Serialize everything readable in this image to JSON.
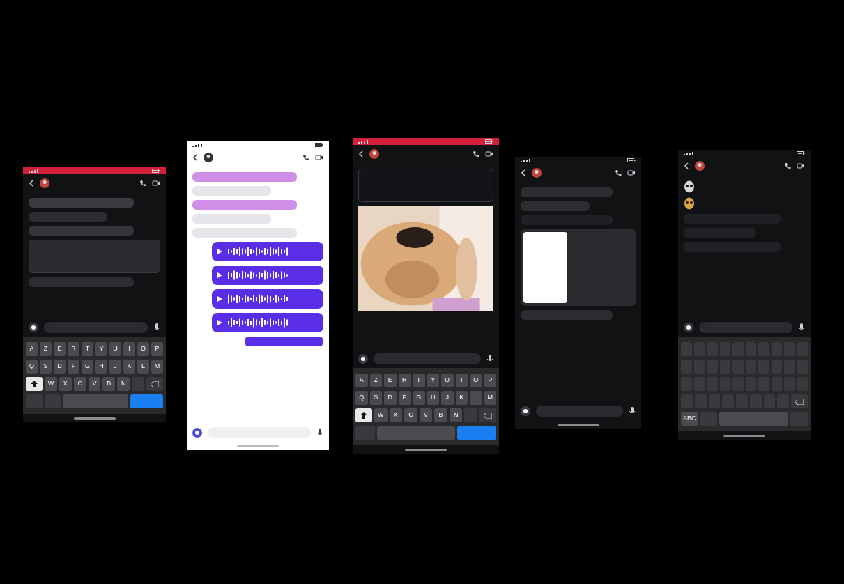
{
  "phones": [
    {
      "kind": "dark",
      "status_bar": {
        "color": "#d3203a"
      },
      "blocks": [
        {
          "kind": "bar-left",
          "color": "#3a3b40"
        },
        {
          "kind": "bar-left",
          "color": "#2c2d31"
        },
        {
          "kind": "bar-left",
          "color": "#34353a"
        },
        {
          "kind": "card-left",
          "color": "#2a2b30"
        },
        {
          "kind": "bar-left",
          "color": "#2c2d31"
        }
      ],
      "keyboard": {
        "rows": [
          [
            {
              "label": "A"
            },
            {
              "label": "Z"
            },
            {
              "label": "E"
            },
            {
              "label": "R"
            },
            {
              "label": "T"
            },
            {
              "label": "Y"
            },
            {
              "label": "U"
            },
            {
              "label": "I"
            },
            {
              "label": "O"
            },
            {
              "label": "P"
            }
          ],
          [
            {
              "label": "Q"
            },
            {
              "label": "S"
            },
            {
              "label": "D"
            },
            {
              "label": "F"
            },
            {
              "label": "G"
            },
            {
              "label": "H"
            },
            {
              "label": "J"
            },
            {
              "label": "K"
            },
            {
              "label": "L"
            },
            {
              "label": "M"
            }
          ],
          [
            {
              "kind": "shift"
            },
            {
              "label": "W"
            },
            {
              "label": "X"
            },
            {
              "label": "C"
            },
            {
              "label": "V"
            },
            {
              "label": "B"
            },
            {
              "label": "N"
            },
            {
              "kind": "blank"
            },
            {
              "kind": "backspace"
            }
          ],
          [
            {
              "kind": "blank"
            },
            {
              "kind": "blank"
            },
            {
              "kind": "space"
            },
            {
              "kind": "action",
              "color": "#1a7ff0"
            }
          ]
        ]
      }
    },
    {
      "kind": "light",
      "blocks": [
        {
          "kind": "bar-left",
          "color": "#cf8fe6"
        },
        {
          "kind": "bar-left",
          "color": "#e6e6ea"
        },
        {
          "kind": "bar-left",
          "color": "#cf8fe6"
        },
        {
          "kind": "bar-left",
          "color": "#e6e6ea"
        },
        {
          "kind": "bar-left",
          "color": "#e6e6ea"
        },
        {
          "kind": "voice-right",
          "color": "#5a2ee6"
        },
        {
          "kind": "voice-right",
          "color": "#5a2ee6"
        },
        {
          "kind": "voice-right",
          "color": "#5a2ee6"
        },
        {
          "kind": "voice-right",
          "color": "#5a2ee6"
        },
        {
          "kind": "bar-right",
          "color": "#5a2ee6"
        }
      ]
    },
    {
      "kind": "dark",
      "status_bar": {
        "color": "#d3203a"
      },
      "blocks": [
        {
          "kind": "card-left",
          "color": "#15121a"
        },
        {
          "kind": "picture"
        }
      ],
      "keyboard": {
        "rows": [
          [
            {
              "label": "A"
            },
            {
              "label": "Z"
            },
            {
              "label": "E"
            },
            {
              "label": "R"
            },
            {
              "label": "T"
            },
            {
              "label": "Y"
            },
            {
              "label": "U"
            },
            {
              "label": "I"
            },
            {
              "label": "O"
            },
            {
              "label": "P"
            }
          ],
          [
            {
              "label": "Q"
            },
            {
              "label": "S"
            },
            {
              "label": "D"
            },
            {
              "label": "F"
            },
            {
              "label": "G"
            },
            {
              "label": "H"
            },
            {
              "label": "J"
            },
            {
              "label": "K"
            },
            {
              "label": "L"
            },
            {
              "label": "M"
            }
          ],
          [
            {
              "kind": "shift"
            },
            {
              "label": "W"
            },
            {
              "label": "X"
            },
            {
              "label": "C"
            },
            {
              "label": "V"
            },
            {
              "label": "B"
            },
            {
              "label": "N"
            },
            {
              "kind": "blank"
            },
            {
              "kind": "backspace"
            }
          ],
          [
            {
              "kind": "blank"
            },
            {
              "kind": "space"
            },
            {
              "kind": "action",
              "color": "#1a7ff0"
            }
          ]
        ]
      }
    },
    {
      "kind": "dark",
      "blocks": [
        {
          "kind": "bar-left",
          "color": "#2c2d31"
        },
        {
          "kind": "bar-left",
          "color": "#2c2d31"
        },
        {
          "kind": "bar-left",
          "color": "#1f2023"
        },
        {
          "kind": "document-left",
          "color": "#2a2b2e"
        },
        {
          "kind": "bar-left",
          "color": "#2c2d31"
        }
      ]
    },
    {
      "kind": "dark",
      "blocks": [
        {
          "kind": "emoji-left",
          "color": "#d8d8d8"
        },
        {
          "kind": "emoji-left",
          "color": "#d9a441"
        },
        {
          "kind": "bar-left",
          "color": "#1f2023"
        },
        {
          "kind": "bar-left",
          "color": "#1f2023"
        },
        {
          "kind": "bar-left",
          "color": "#1f2023"
        }
      ],
      "keyboard": {
        "rows": [
          [
            {
              "kind": "blank"
            },
            {
              "kind": "blank"
            },
            {
              "kind": "blank"
            },
            {
              "kind": "blank"
            },
            {
              "kind": "blank"
            },
            {
              "kind": "blank"
            },
            {
              "kind": "blank"
            },
            {
              "kind": "blank"
            },
            {
              "kind": "blank"
            },
            {
              "kind": "blank"
            }
          ],
          [
            {
              "kind": "blank"
            },
            {
              "kind": "blank"
            },
            {
              "kind": "blank"
            },
            {
              "kind": "blank"
            },
            {
              "kind": "blank"
            },
            {
              "kind": "blank"
            },
            {
              "kind": "blank"
            },
            {
              "kind": "blank"
            },
            {
              "kind": "blank"
            },
            {
              "kind": "blank"
            }
          ],
          [
            {
              "kind": "blank"
            },
            {
              "kind": "blank"
            },
            {
              "kind": "blank"
            },
            {
              "kind": "blank"
            },
            {
              "kind": "blank"
            },
            {
              "kind": "blank"
            },
            {
              "kind": "blank"
            },
            {
              "kind": "blank"
            },
            {
              "kind": "blank"
            },
            {
              "kind": "blank"
            }
          ],
          [
            {
              "kind": "blank"
            },
            {
              "kind": "blank"
            },
            {
              "kind": "blank"
            },
            {
              "kind": "blank"
            },
            {
              "kind": "blank"
            },
            {
              "kind": "blank"
            },
            {
              "kind": "blank"
            },
            {
              "kind": "blank"
            },
            {
              "kind": "backspace"
            }
          ],
          [
            {
              "label": "ABC"
            },
            {
              "kind": "blank"
            },
            {
              "kind": "space"
            },
            {
              "kind": "blank"
            }
          ]
        ]
      }
    }
  ]
}
